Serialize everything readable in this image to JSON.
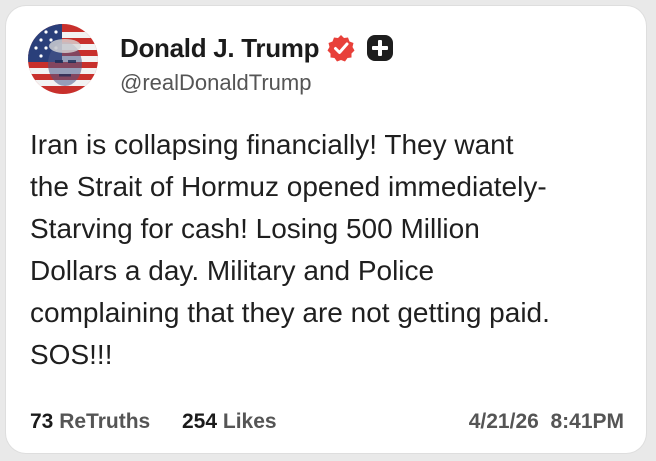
{
  "post": {
    "author": {
      "display_name": "Donald J. Trump",
      "handle": "@realDonaldTrump",
      "avatar_icon": "flag-portrait-avatar",
      "verified_icon": "verified-badge-icon",
      "verified_color": "#e8403a",
      "follow_icon": "plus-icon"
    },
    "lines": [
      "Iran is collapsing financially! They want",
      "the Strait of Hormuz opened immediately-",
      "Starving for cash! Losing 500 Million",
      "Dollars a day. Military and Police",
      "complaining that they are not getting paid.",
      "SOS!!!"
    ],
    "stats": {
      "retruths_count": "73",
      "retruths_label": "ReTruths",
      "likes_count": "254",
      "likes_label": "Likes"
    },
    "timestamp": "4/21/26  8:41PM"
  }
}
